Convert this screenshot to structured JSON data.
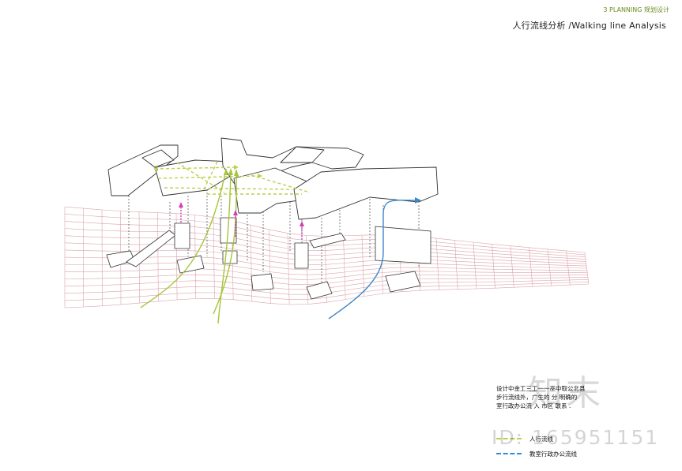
{
  "header": {
    "section": "3 PLANNING 规划设计",
    "title": "人行流线分析 /Walking line  Analysis"
  },
  "description": {
    "line1": "设计中金工三工一一巫中取公北县",
    "line2": "步行流线外，广生的 分 明确的",
    "line3": "室行政办公流 入 市区 联系 ."
  },
  "legend": {
    "items": [
      {
        "label": "人行流线",
        "color": "#b8d14a"
      },
      {
        "label": "教室行政办公流线",
        "color": "#2a8fd6"
      }
    ]
  },
  "watermark": {
    "text": "知末",
    "id": "ID: 165951151"
  },
  "colors": {
    "grid": "#d9a0a8",
    "pedestrian": "#a7c53a",
    "office": "#3b87c9",
    "vertical": "#d13fb0"
  }
}
